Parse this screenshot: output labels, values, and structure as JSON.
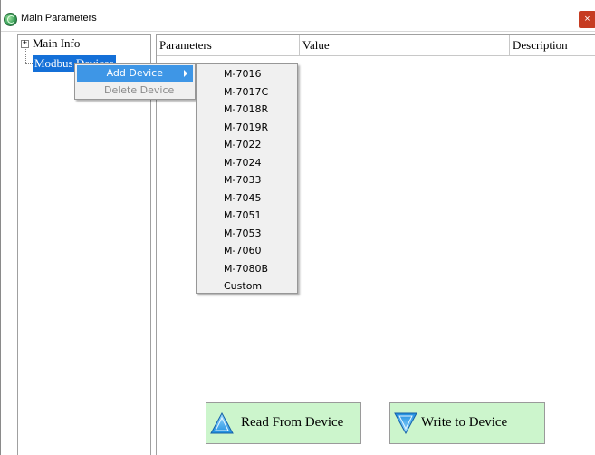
{
  "window": {
    "title": "Main Parameters",
    "close_glyph": "×"
  },
  "tree": {
    "expander": "+",
    "nodes": [
      {
        "label": "Main Info"
      },
      {
        "label": "Modbus Devices"
      }
    ]
  },
  "list": {
    "columns": [
      "Parameters",
      "Value",
      "Description"
    ]
  },
  "context_menu": {
    "items": [
      {
        "label": "Add Device",
        "has_submenu": true,
        "enabled": true
      },
      {
        "label": "Delete Device",
        "enabled": false
      }
    ]
  },
  "submenu": {
    "items": [
      "M-7016",
      "M-7017C",
      "M-7018R",
      "M-7019R",
      "M-7022",
      "M-7024",
      "M-7033",
      "M-7045",
      "M-7051",
      "M-7053",
      "M-7060",
      "M-7080B",
      "Custom"
    ]
  },
  "buttons": {
    "read_label": "Read From Device",
    "write_label": "Write to Device"
  },
  "colors": {
    "selection": "#1470d8",
    "menu_highlight": "#3e96e6",
    "button_bg": "#ccf5cc",
    "close_bg": "#c63c22"
  },
  "icons": [
    "app-icon",
    "close-icon",
    "arrow-up-icon",
    "arrow-down-icon",
    "submenu-arrow-icon"
  ]
}
